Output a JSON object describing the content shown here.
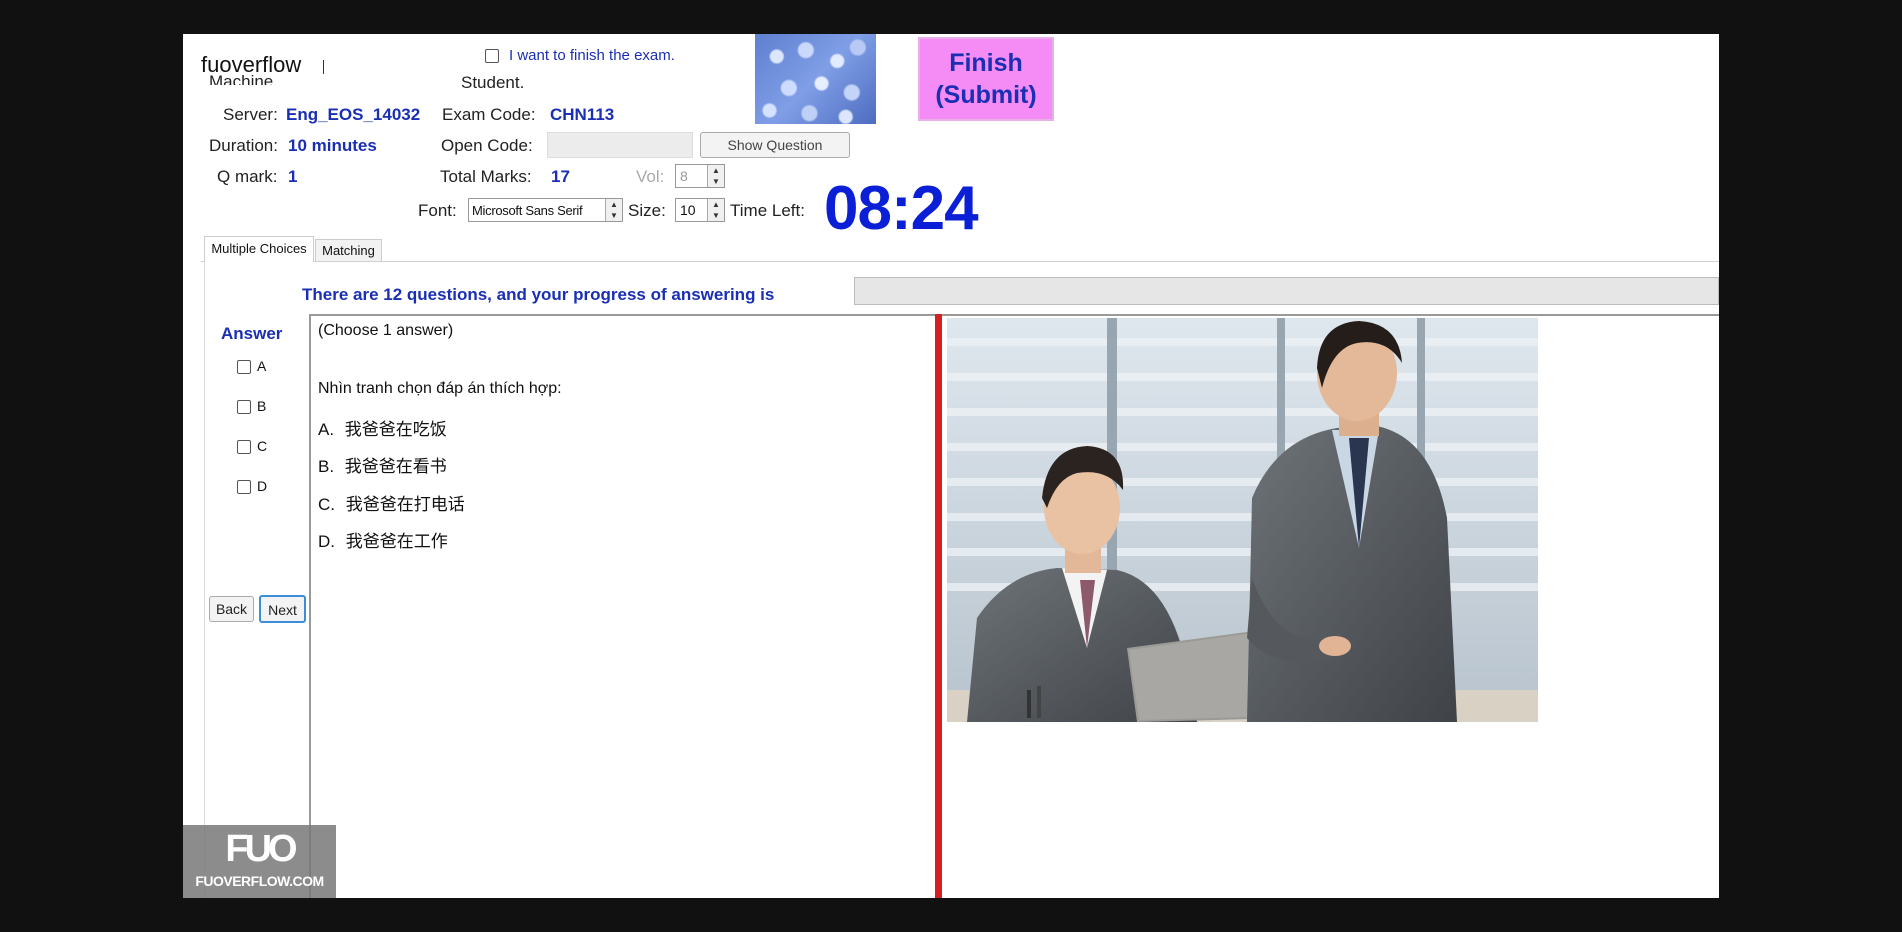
{
  "brand": "fuoverflow",
  "finish_checkbox_label": "I want to finish the exam.",
  "header": {
    "machine_label": "Machine",
    "student_label": "Student.",
    "server_label": "Server:",
    "server_value": "Eng_EOS_14032",
    "exam_code_label": "Exam Code:",
    "exam_code_value": "CHN113",
    "duration_label": "Duration:",
    "duration_value": "10 minutes",
    "open_code_label": "Open Code:",
    "show_question_label": "Show Question",
    "qmark_label": "Q mark:",
    "qmark_value": "1",
    "total_marks_label": "Total Marks:",
    "total_marks_value": "17",
    "vol_label": "Vol:",
    "vol_value": "8",
    "font_label": "Font:",
    "font_value": "Microsoft Sans Serif",
    "size_label": "Size:",
    "size_value": "10",
    "time_left_label": "Time Left:",
    "timer": "08:24"
  },
  "finish_button": {
    "line1": "Finish",
    "line2": "(Submit)"
  },
  "tabs": [
    "Multiple Choices",
    "Matching"
  ],
  "progress_text": "There are 12 questions, and your progress of answering is",
  "progress_fraction": 0,
  "answer_title": "Answer",
  "answers": [
    "A",
    "B",
    "C",
    "D"
  ],
  "nav": {
    "back": "Back",
    "next": "Next"
  },
  "question": {
    "instruction": "(Choose 1 answer)",
    "prompt": "Nhìn tranh chọn đáp án thích hợp:",
    "options": [
      {
        "letter": "A.",
        "text": "我爸爸在吃饭"
      },
      {
        "letter": "B.",
        "text": "我爸爸在看书"
      },
      {
        "letter": "C.",
        "text": "我爸爸在打电话"
      },
      {
        "letter": "D.",
        "text": "我爸爸在工作"
      }
    ]
  },
  "watermark": {
    "logo": "FUO",
    "site": "FUOVERFLOW.COM"
  },
  "colors": {
    "accent_blue": "#1a2fb3",
    "timer_blue": "#0a1fd6",
    "finish_bg": "#f58cf5",
    "divider_red": "#d42020"
  },
  "icons": {
    "avatar": "blue-hydrangea-photo",
    "question_image": "two-businessmen-at-laptop-photo"
  }
}
